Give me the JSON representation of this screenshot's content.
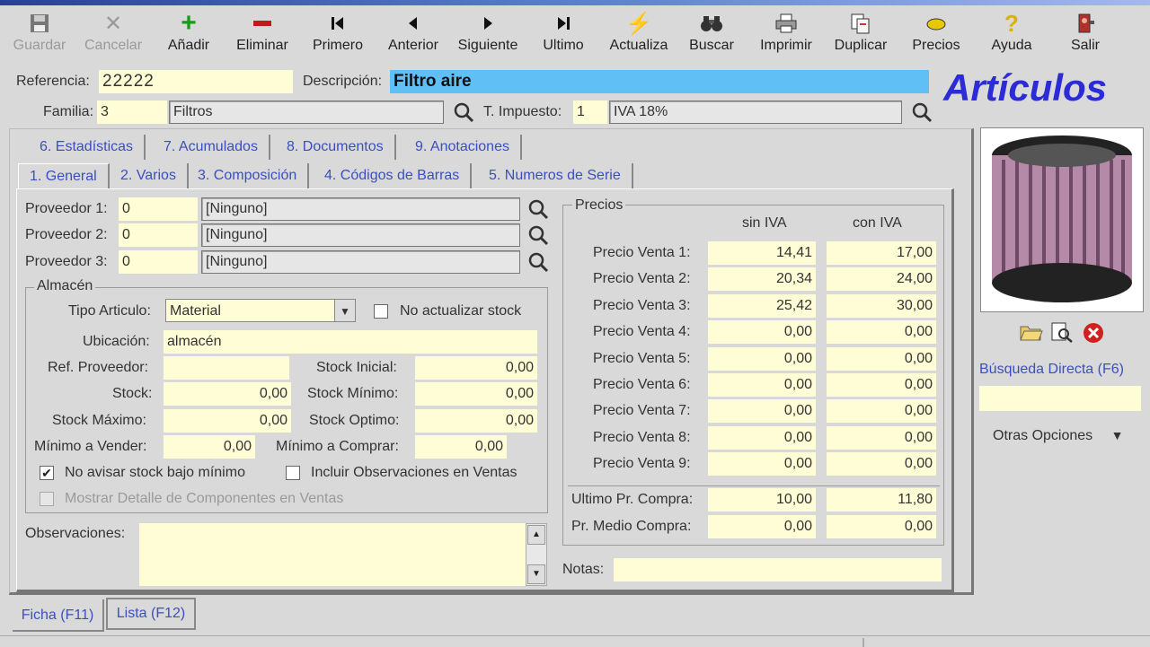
{
  "toolbar": {
    "guardar": "Guardar",
    "cancelar": "Cancelar",
    "anadir": "Añadir",
    "eliminar": "Eliminar",
    "primero": "Primero",
    "anterior": "Anterior",
    "siguiente": "Siguiente",
    "ultimo": "Ultimo",
    "actualiza": "Actualiza",
    "buscar": "Buscar",
    "imprimir": "Imprimir",
    "duplicar": "Duplicar",
    "precios": "Precios",
    "ayuda": "Ayuda",
    "salir": "Salir"
  },
  "header": {
    "referencia_label": "Referencia:",
    "referencia_value": "22222",
    "descripcion_label": "Descripción:",
    "descripcion_value": "Filtro aire",
    "familia_label": "Familia:",
    "familia_code": "3",
    "familia_name": "Filtros",
    "impuesto_label": "T. Impuesto:",
    "impuesto_code": "1",
    "impuesto_name": "IVA 18%",
    "title": "Artículos"
  },
  "tabs_top": [
    "6. Estadísticas",
    "7. Acumulados",
    "8. Documentos",
    "9. Anotaciones"
  ],
  "tabs_bottom": [
    "1. General",
    "2. Varios",
    "3. Composición",
    "4. Códigos de Barras",
    "5. Numeros de Serie"
  ],
  "proveedores": [
    {
      "label": "Proveedor 1:",
      "code": "0",
      "name": "[Ninguno]"
    },
    {
      "label": "Proveedor 2:",
      "code": "0",
      "name": "[Ninguno]"
    },
    {
      "label": "Proveedor 3:",
      "code": "0",
      "name": "[Ninguno]"
    }
  ],
  "almacen": {
    "title": "Almacén",
    "tipo_label": "Tipo Articulo:",
    "tipo_value": "Material",
    "no_actualizar": "No actualizar stock",
    "ubicacion_label": "Ubicación:",
    "ubicacion_value": "almacén",
    "ref_prov_label": "Ref. Proveedor:",
    "stock_inicial_label": "Stock Inicial:",
    "stock_inicial": "0,00",
    "stock_label": "Stock:",
    "stock": "0,00",
    "stock_minimo_label": "Stock Mínimo:",
    "stock_minimo": "0,00",
    "stock_maximo_label": "Stock Máximo:",
    "stock_maximo": "0,00",
    "stock_optimo_label": "Stock Optimo:",
    "stock_optimo": "0,00",
    "min_vender_label": "Mínimo a Vender:",
    "min_vender": "0,00",
    "min_comprar_label": "Mínimo a Comprar:",
    "min_comprar": "0,00",
    "no_avisar": "No avisar stock bajo mínimo",
    "incluir_obs": "Incluir Observaciones en Ventas",
    "mostrar_detalle": "Mostrar Detalle de Componentes en Ventas"
  },
  "observaciones_label": "Observaciones:",
  "precios": {
    "title": "Precios",
    "col_sin": "sin IVA",
    "col_con": "con IVA",
    "rows": [
      {
        "label": "Precio Venta 1:",
        "sin": "14,41",
        "con": "17,00"
      },
      {
        "label": "Precio Venta 2:",
        "sin": "20,34",
        "con": "24,00"
      },
      {
        "label": "Precio Venta 3:",
        "sin": "25,42",
        "con": "30,00"
      },
      {
        "label": "Precio Venta 4:",
        "sin": "0,00",
        "con": "0,00"
      },
      {
        "label": "Precio Venta 5:",
        "sin": "0,00",
        "con": "0,00"
      },
      {
        "label": "Precio Venta 6:",
        "sin": "0,00",
        "con": "0,00"
      },
      {
        "label": "Precio Venta 7:",
        "sin": "0,00",
        "con": "0,00"
      },
      {
        "label": "Precio Venta 8:",
        "sin": "0,00",
        "con": "0,00"
      },
      {
        "label": "Precio Venta 9:",
        "sin": "0,00",
        "con": "0,00"
      }
    ],
    "ultimo_label": "Ultimo Pr. Compra:",
    "ultimo_sin": "10,00",
    "ultimo_con": "11,80",
    "medio_label": "Pr. Medio Compra:",
    "medio_sin": "0,00",
    "medio_con": "0,00"
  },
  "notas_label": "Notas:",
  "side": {
    "busqueda": "Búsqueda Directa (F6)",
    "otras": "Otras Opciones"
  },
  "bottom_tabs": {
    "ficha": "Ficha (F11)",
    "lista": "Lista (F12)"
  },
  "colors": {
    "accent_title": "#2b2bd8",
    "input_bg": "#fffdd5",
    "selected_bg": "#60bff5",
    "tab_text": "#3a4fc0"
  }
}
